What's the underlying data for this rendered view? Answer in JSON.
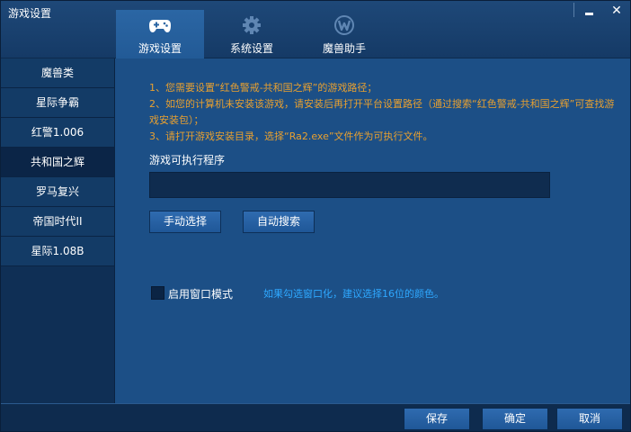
{
  "window": {
    "title": "游戏设置"
  },
  "tabs": [
    {
      "label": "游戏设置",
      "icon": "gamepad-icon",
      "active": true
    },
    {
      "label": "系统设置",
      "icon": "gear-icon",
      "active": false
    },
    {
      "label": "魔兽助手",
      "icon": "warcraft-logo-icon",
      "active": false
    }
  ],
  "sidebar": {
    "items": [
      {
        "label": "魔兽类"
      },
      {
        "label": "星际争霸"
      },
      {
        "label": "红警1.006"
      },
      {
        "label": "共和国之辉",
        "active": true
      },
      {
        "label": "罗马复兴"
      },
      {
        "label": "帝国时代II"
      },
      {
        "label": "星际1.08B"
      }
    ]
  },
  "main": {
    "instructions": [
      "1、您需要设置“红色警戒-共和国之辉”的游戏路径；",
      "2、如您的计算机未安装该游戏，请安装后再打开平台设置路径（通过搜索“红色警戒-共和国之辉”可查找游戏安装包）；",
      "3、请打开游戏安装目录，选择“Ra2.exe”文件作为可执行文件。"
    ],
    "exe_label": "游戏可执行程序",
    "exe_path": "",
    "manual_select": "手动选择",
    "auto_search": "自动搜索",
    "window_mode_label": "启用窗口模式",
    "window_mode_tip": "如果勾选窗口化，建议选择16位的颜色。"
  },
  "footer": {
    "save": "保存",
    "ok": "确定",
    "cancel": "取消"
  },
  "colors": {
    "instruction_text": "#e8a030",
    "tip_text": "#2ea8ff",
    "panel_bg": "#1c4f86"
  }
}
